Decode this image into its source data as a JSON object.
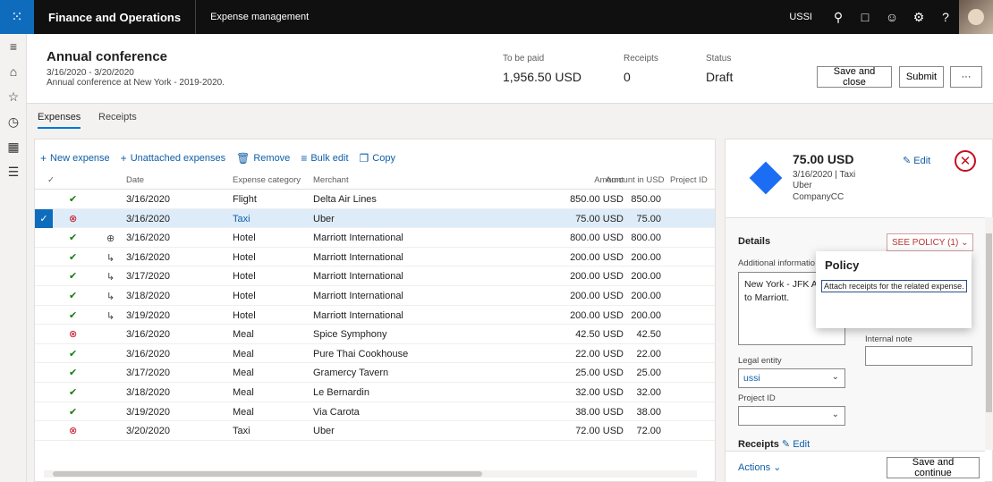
{
  "topbar": {
    "app_name": "Finance and Operations",
    "module": "Expense management",
    "company": "USSI"
  },
  "report": {
    "title": "Annual conference",
    "dates": "3/16/2020 - 3/20/2020",
    "description": "Annual conference at New York - 2019-2020.",
    "to_be_paid_label": "To be paid",
    "to_be_paid": "1,956.50 USD",
    "receipts_label": "Receipts",
    "receipts": "0",
    "status_label": "Status",
    "status": "Draft",
    "save_close": "Save and close",
    "submit": "Submit",
    "more": "···"
  },
  "tabs": [
    {
      "label": "Expenses",
      "active": true
    },
    {
      "label": "Receipts",
      "active": false
    }
  ],
  "toolbar": {
    "new_expense": "New expense",
    "unattached": "Unattached expenses",
    "remove": "Remove",
    "bulk_edit": "Bulk edit",
    "copy": "Copy"
  },
  "grid": {
    "headers": {
      "check": "✓",
      "date": "Date",
      "category": "Expense category",
      "merchant": "Merchant",
      "amount": "Amount",
      "amount_usd": "Amount in USD",
      "project": "Project ID"
    },
    "rows": [
      {
        "status": "ok",
        "marker": "",
        "date": "3/16/2020",
        "category": "Flight",
        "merchant": "Delta Air Lines",
        "amount": "850.00 USD",
        "amount_usd": "850.00"
      },
      {
        "status": "bad",
        "marker": "",
        "date": "3/16/2020",
        "category": "Taxi",
        "merchant": "Uber",
        "amount": "75.00 USD",
        "amount_usd": "75.00",
        "selected": true
      },
      {
        "status": "ok",
        "marker": "⊕",
        "date": "3/16/2020",
        "category": "Hotel",
        "merchant": "Marriott International",
        "amount": "800.00 USD",
        "amount_usd": "800.00"
      },
      {
        "status": "ok",
        "marker": "↳",
        "date": "3/16/2020",
        "category": "Hotel",
        "merchant": "Marriott International",
        "amount": "200.00 USD",
        "amount_usd": "200.00"
      },
      {
        "status": "ok",
        "marker": "↳",
        "date": "3/17/2020",
        "category": "Hotel",
        "merchant": "Marriott International",
        "amount": "200.00 USD",
        "amount_usd": "200.00"
      },
      {
        "status": "ok",
        "marker": "↳",
        "date": "3/18/2020",
        "category": "Hotel",
        "merchant": "Marriott International",
        "amount": "200.00 USD",
        "amount_usd": "200.00"
      },
      {
        "status": "ok",
        "marker": "↳",
        "date": "3/19/2020",
        "category": "Hotel",
        "merchant": "Marriott International",
        "amount": "200.00 USD",
        "amount_usd": "200.00"
      },
      {
        "status": "bad",
        "marker": "",
        "date": "3/16/2020",
        "category": "Meal",
        "merchant": "Spice Symphony",
        "amount": "42.50 USD",
        "amount_usd": "42.50"
      },
      {
        "status": "ok",
        "marker": "",
        "date": "3/16/2020",
        "category": "Meal",
        "merchant": "Pure Thai Cookhouse",
        "amount": "22.00 USD",
        "amount_usd": "22.00"
      },
      {
        "status": "ok",
        "marker": "",
        "date": "3/17/2020",
        "category": "Meal",
        "merchant": "Gramercy Tavern",
        "amount": "25.00 USD",
        "amount_usd": "25.00"
      },
      {
        "status": "ok",
        "marker": "",
        "date": "3/18/2020",
        "category": "Meal",
        "merchant": "Le Bernardin",
        "amount": "32.00 USD",
        "amount_usd": "32.00"
      },
      {
        "status": "ok",
        "marker": "",
        "date": "3/19/2020",
        "category": "Meal",
        "merchant": "Via Carota",
        "amount": "38.00 USD",
        "amount_usd": "38.00"
      },
      {
        "status": "bad",
        "marker": "",
        "date": "3/20/2020",
        "category": "Taxi",
        "merchant": "Uber",
        "amount": "72.00 USD",
        "amount_usd": "72.00"
      }
    ]
  },
  "side": {
    "amount": "75.00 USD",
    "date_category": "3/16/2020 | Taxi",
    "merchant": "Uber",
    "payment": "CompanyCC",
    "edit": "Edit",
    "details": "Details",
    "see_policy": "SEE POLICY (1)",
    "additional_info_label": "Additional informatio",
    "additional_info_line1": "New York - JFK Air",
    "additional_info_line2": "to Marriott.",
    "internal_note_label": "Internal note",
    "legal_entity_label": "Legal entity",
    "legal_entity": "ussi",
    "project_label": "Project ID",
    "project": "",
    "receipts": "Receipts",
    "receipts_edit": "Edit",
    "actions": "Actions",
    "save_continue": "Save and continue"
  },
  "policy_popup": {
    "title": "Policy",
    "message": "Attach receipts for the related expense."
  },
  "colors": {
    "accent": "#0f6cbd",
    "ok": "#107c10",
    "error": "#c50f1f"
  }
}
